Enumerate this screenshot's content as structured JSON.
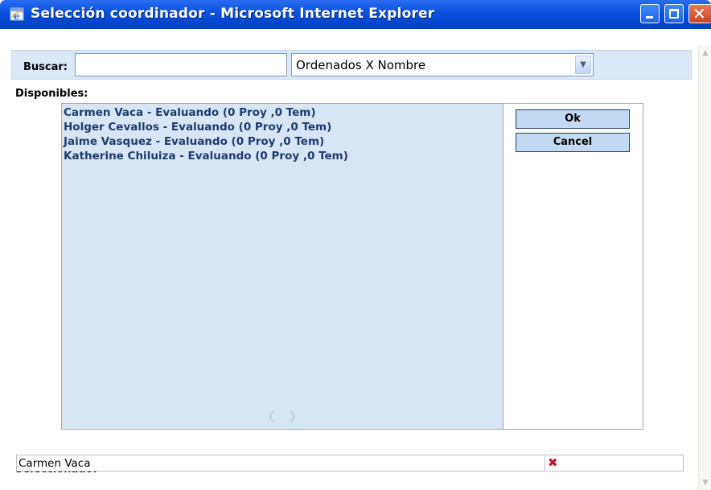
{
  "window": {
    "title": "Selección coordinador - Microsoft Internet Explorer",
    "app_icon": "ie-icon",
    "controls": {
      "minimize": "minimize-icon",
      "maximize": "maximize-icon",
      "close": "close-icon"
    }
  },
  "search": {
    "label": "Buscar:",
    "value": "",
    "sort_selected": "Ordenados X Nombre"
  },
  "available": {
    "label": "Disponibles:",
    "items": [
      "Carmen Vaca - Evaluando (0 Proy ,0 Tem)",
      "Holger Cevallos - Evaluando (0 Proy ,0 Tem)",
      "Jaime Vasquez - Evaluando (0 Proy ,0 Tem)",
      "Katherine Chiluiza - Evaluando (0 Proy ,0 Tem)"
    ]
  },
  "buttons": {
    "ok": "Ok",
    "cancel": "Cancel"
  },
  "selected": {
    "label": "Seleccionado:",
    "name": "Carmen Vaca",
    "remove_glyph": "✖"
  },
  "colors": {
    "titlebar": "#0548d2",
    "search_bar": "#dbe8f7",
    "list_bg": "#d6e6f5",
    "list_text": "#1d3c6c",
    "button_bg": "#c3daf5",
    "remove": "#c0152b"
  }
}
